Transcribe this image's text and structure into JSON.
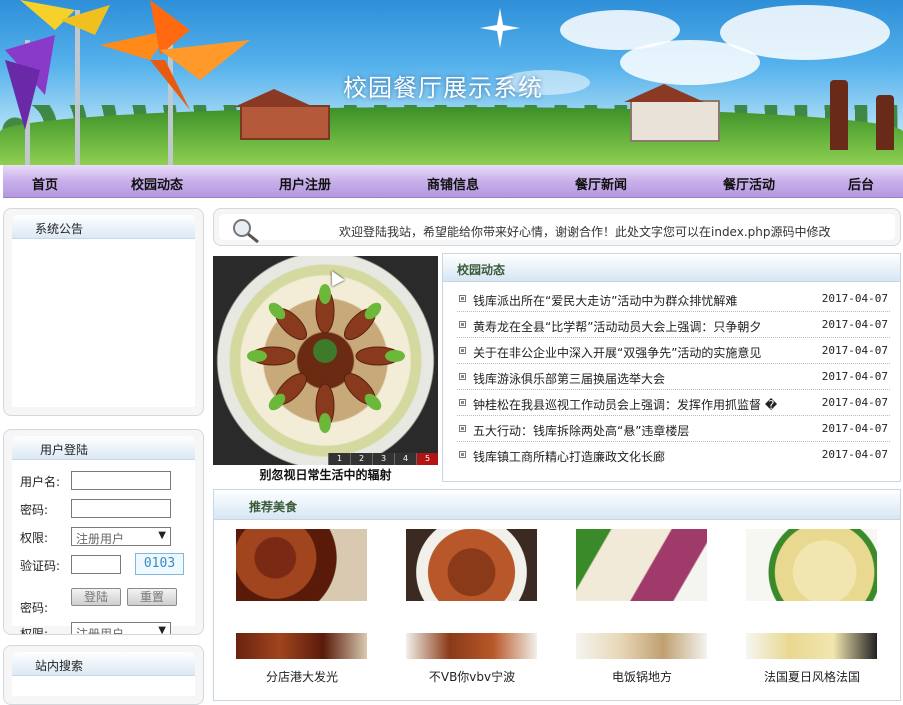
{
  "header": {
    "site_title": "校园餐厅展示系统"
  },
  "nav": {
    "items": [
      "首页",
      "校园动态",
      "用户注册",
      "商铺信息",
      "餐厅新闻",
      "餐厅活动",
      "后台"
    ]
  },
  "notice_panel": {
    "title": "系统公告"
  },
  "login_panel": {
    "title": "用户登陆",
    "username_label": "用户名:",
    "password_label": "密码:",
    "role_label": "权限:",
    "role_value": "注册用户",
    "captcha_label": "验证码:",
    "captcha_code": "0103",
    "login_button": "登陆",
    "reset_button": "重置",
    "overflow_password_label": "密码:",
    "overflow_role_label": "权限:",
    "overflow_role_value": "注册用户"
  },
  "search_panel": {
    "title": "站内搜索"
  },
  "welcome": {
    "message": "欢迎登陆我站，希望能给你带来好心情，谢谢合作！此处文字您可以在index.php源码中修改"
  },
  "slideshow": {
    "caption": "别忽视日常生活中的辐射",
    "pages": [
      "1",
      "2",
      "3",
      "4",
      "5"
    ],
    "active_page": "5"
  },
  "news": {
    "title": "校园动态",
    "items": [
      {
        "title": "钱库派出所在“爱民大走访”活动中为群众排忧解难",
        "date": "2017-04-07"
      },
      {
        "title": "黄寿龙在全县“比学帮”活动动员大会上强调：只争朝夕",
        "date": "2017-04-07"
      },
      {
        "title": "关于在非公企业中深入开展“双强争先”活动的实施意见",
        "date": "2017-04-07"
      },
      {
        "title": "钱库游泳俱乐部第三届换届选举大会",
        "date": "2017-04-07"
      },
      {
        "title": "钟桂松在我县巡视工作动员会上强调：发挥作用抓监督 �",
        "date": "2017-04-07"
      },
      {
        "title": "五大行动：钱库拆除两处高“悬”违章楼层",
        "date": "2017-04-07"
      },
      {
        "title": "钱库镇工商所精心打造廉政文化长廊",
        "date": "2017-04-07"
      }
    ]
  },
  "food": {
    "title": "推荐美食",
    "items": [
      {
        "name": "分店港大发光"
      },
      {
        "name": "不VB你vbv宁波"
      },
      {
        "name": "电饭锅地方"
      },
      {
        "name": "法国夏日风格法国"
      }
    ]
  },
  "colors": {
    "nav_bg": "#c8b0ea",
    "panel_head": "#dbe9f5",
    "active_slide": "#b11414",
    "captcha": "#3a8ac0"
  }
}
